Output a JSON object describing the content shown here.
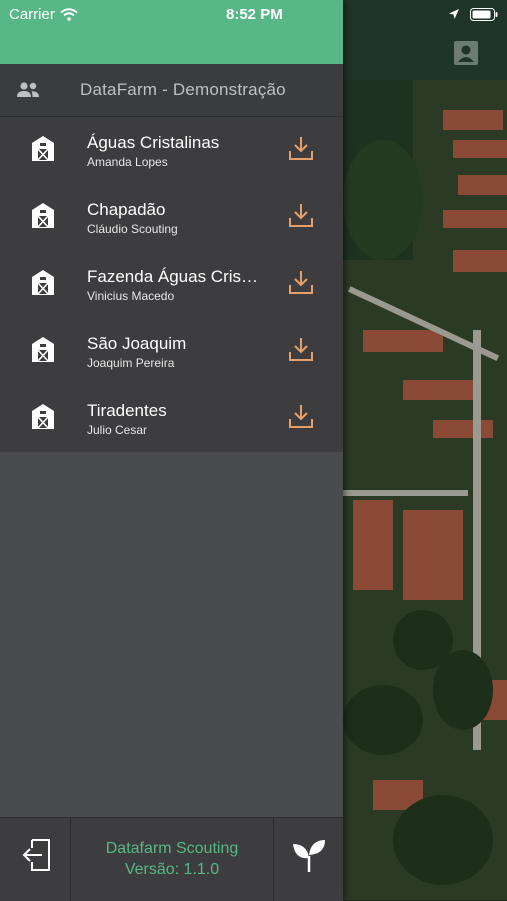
{
  "status_bar": {
    "carrier": "Carrier",
    "time": "8:52 PM"
  },
  "drawer": {
    "organization": "DataFarm - Demonstração",
    "farms": [
      {
        "name": "Águas Cristalinas",
        "owner": "Amanda Lopes"
      },
      {
        "name": "Chapadão",
        "owner": "Cláudio Scouting"
      },
      {
        "name": "Fazenda Águas Cristalinas",
        "owner": "Vinicius Macedo"
      },
      {
        "name": "São Joaquim",
        "owner": "Joaquim Pereira"
      },
      {
        "name": "Tiradentes",
        "owner": "Julio Cesar"
      }
    ],
    "footer": {
      "app_name": "Datafarm Scouting",
      "version": "Versão: 1.1.0"
    }
  },
  "colors": {
    "accent_green": "#58b787",
    "download_orange": "#e8a06a",
    "drawer_bg": "#4a4b4d"
  },
  "icons": [
    "wifi-icon",
    "location-arrow-icon",
    "battery-icon",
    "account-icon",
    "users-icon",
    "barn-icon",
    "download-icon",
    "logout-icon",
    "sprout-icon"
  ]
}
